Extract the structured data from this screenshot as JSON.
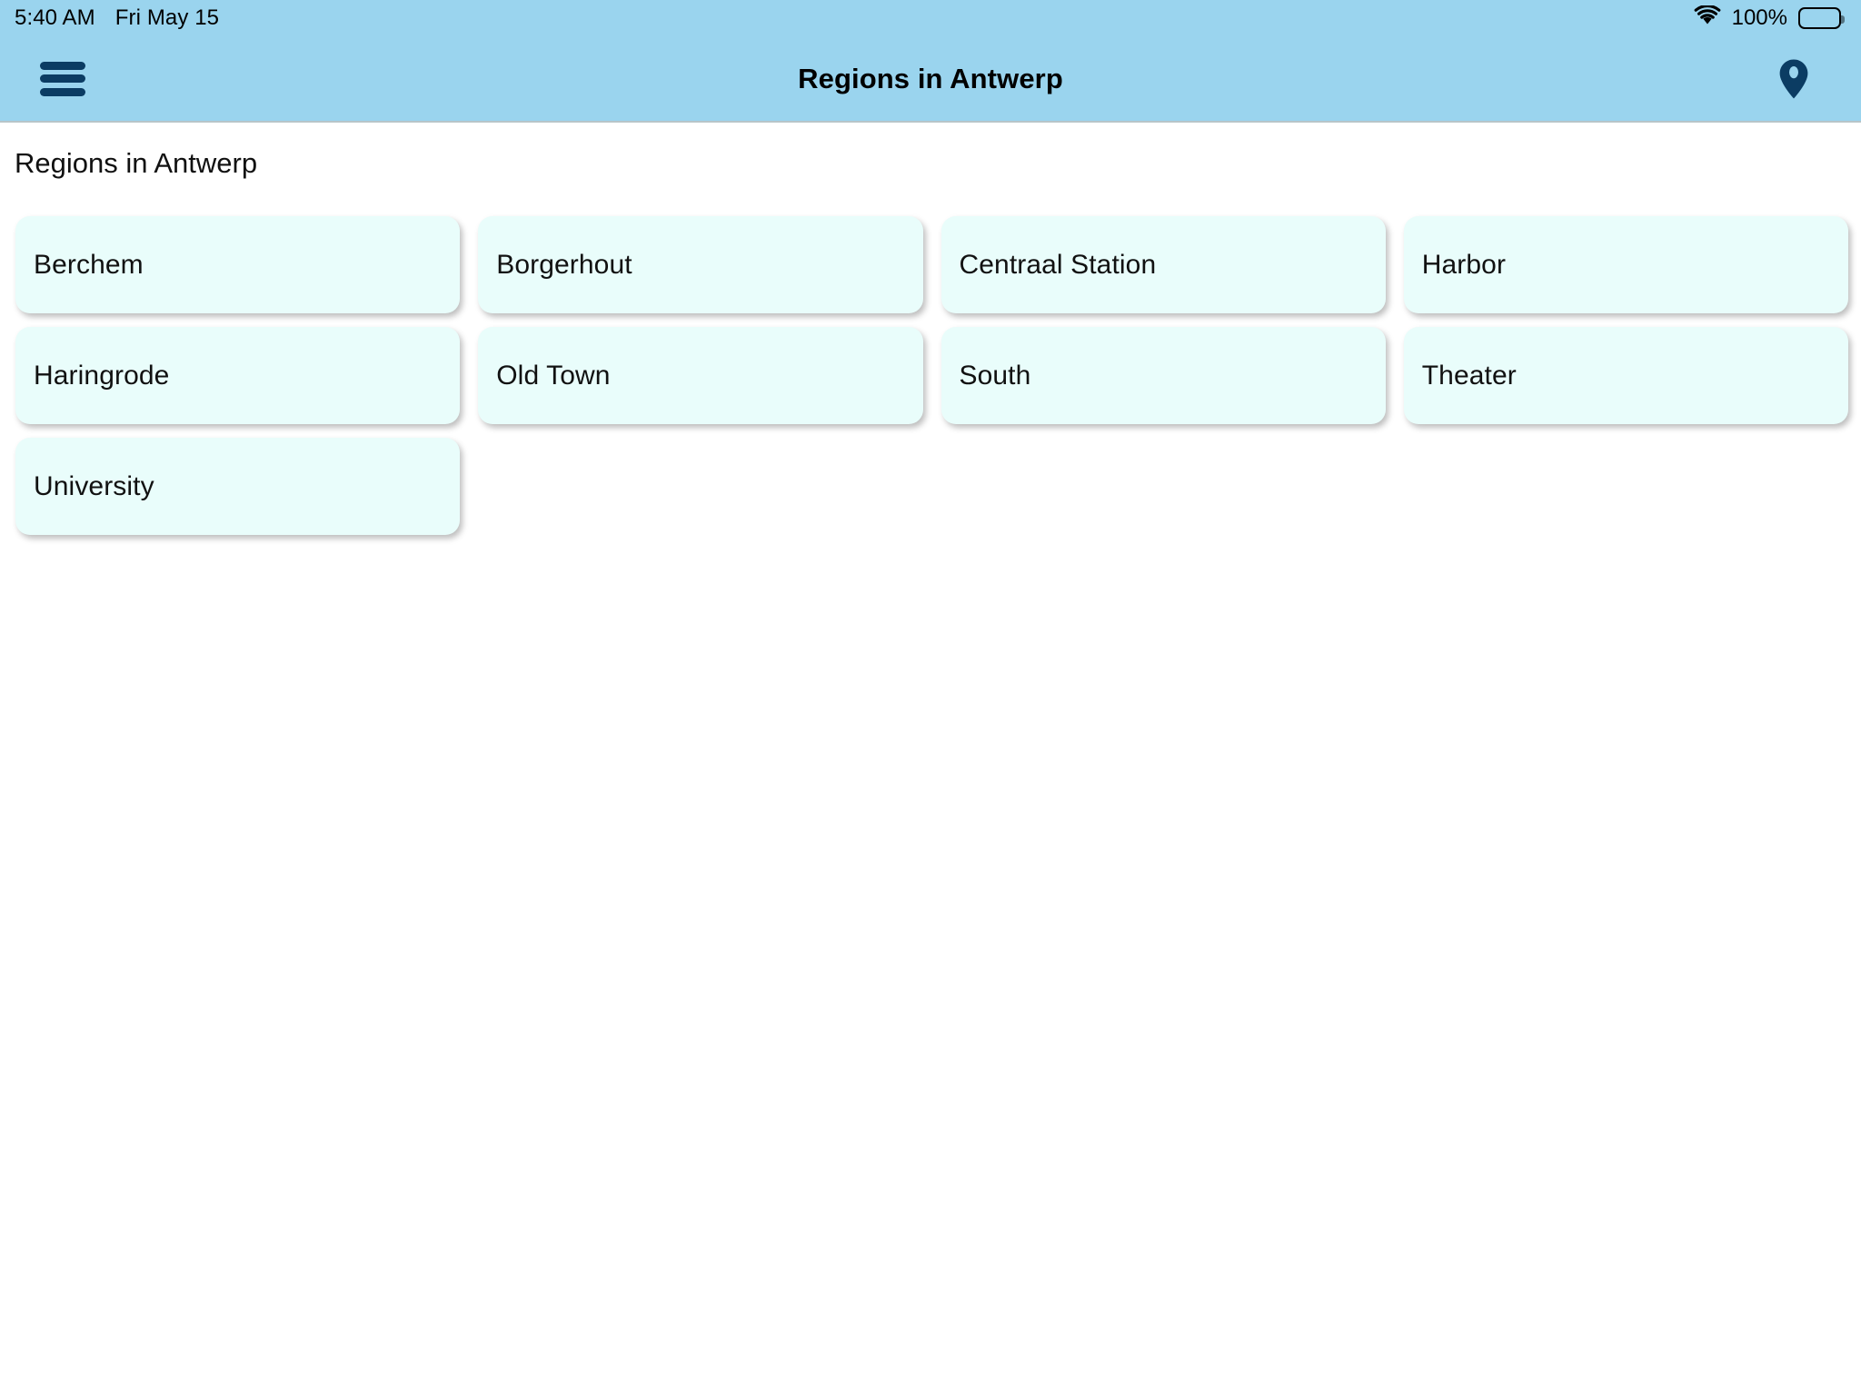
{
  "status_bar": {
    "time": "5:40 AM",
    "date": "Fri May 15",
    "battery_percent": "100%",
    "wifi_icon": "wifi-icon",
    "battery_icon": "battery-full-icon"
  },
  "header": {
    "menu_icon": "hamburger-menu-icon",
    "title": "Regions in Antwerp",
    "action_icon": "map-pin-icon",
    "background_color": "#9ad4ee"
  },
  "main": {
    "heading": "Regions in Antwerp",
    "card_color": "#e9fdfb",
    "regions": [
      {
        "label": "Berchem"
      },
      {
        "label": "Borgerhout"
      },
      {
        "label": "Centraal Station"
      },
      {
        "label": "Harbor"
      },
      {
        "label": "Haringrode"
      },
      {
        "label": "Old Town"
      },
      {
        "label": "South"
      },
      {
        "label": "Theater"
      },
      {
        "label": "University"
      }
    ]
  }
}
